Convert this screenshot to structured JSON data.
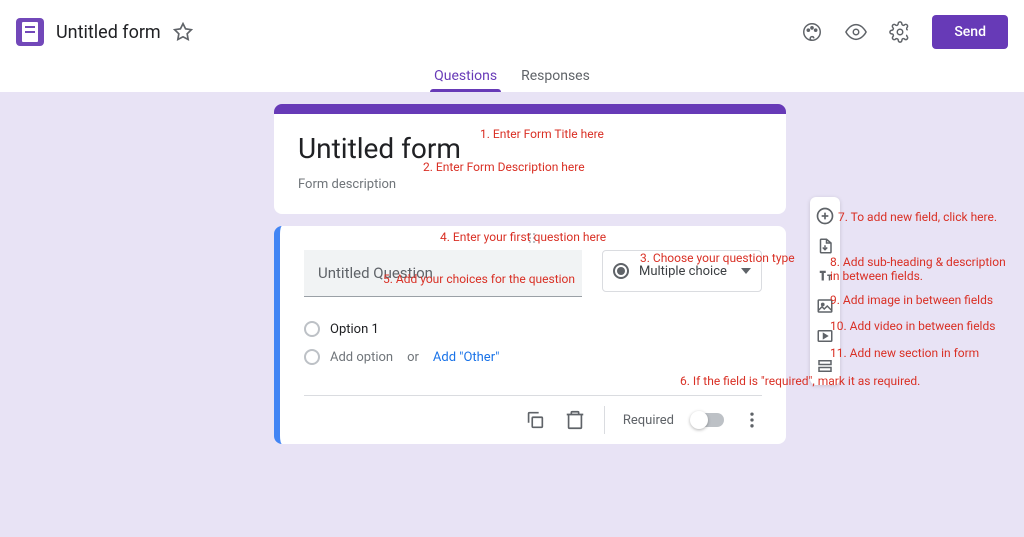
{
  "header": {
    "form_name": "Untitled form",
    "send_label": "Send"
  },
  "tabs": {
    "questions": "Questions",
    "responses": "Responses"
  },
  "title_card": {
    "title": "Untitled form",
    "description": "Form description"
  },
  "question": {
    "text": "Untitled Question",
    "type_label": "Multiple choice",
    "option1": "Option 1",
    "add_option": "Add option",
    "or": "or",
    "add_other": "Add \"Other\"",
    "required_label": "Required"
  },
  "annotations": {
    "a1": "1. Enter Form Title here",
    "a2": "2. Enter Form Description here",
    "a3": "3. Choose your question type",
    "a4": "4. Enter your first question here",
    "a5": "5. Add your choices for the question",
    "a6": "6. If the field is \"required\", mark it as required.",
    "a7": "7. To add new field, click here.",
    "a8": "8. Add sub-heading & description in between fields.",
    "a9": "9. Add image in between fields",
    "a10": "10. Add video in between fields",
    "a11": "11. Add new section in form"
  }
}
